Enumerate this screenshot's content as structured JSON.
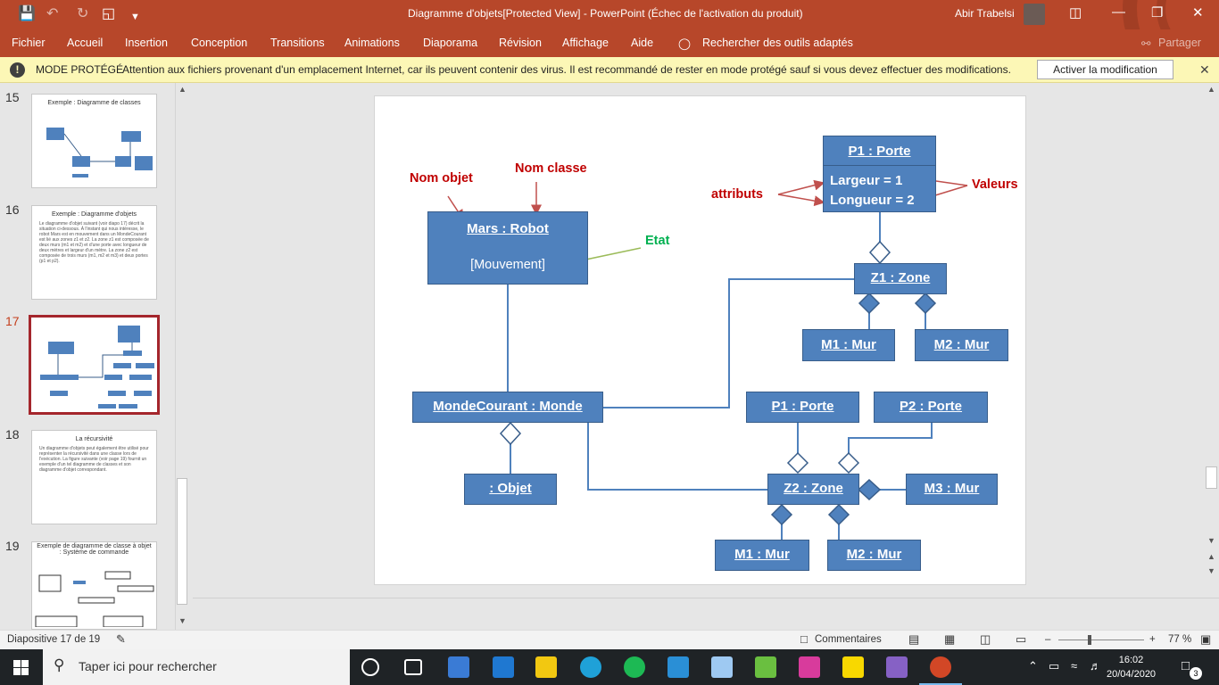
{
  "titlebar": {
    "window_title": "Diagramme d'objets[Protected View]  -  PowerPoint (Échec de l'activation du produit)",
    "user_name": "Abir Trabelsi"
  },
  "menu": {
    "items": [
      "Fichier",
      "Accueil",
      "Insertion",
      "Conception",
      "Transitions",
      "Animations",
      "Diaporama",
      "Révision",
      "Affichage",
      "Aide"
    ],
    "search_label": "Rechercher des outils adaptés",
    "share_label": "Partager"
  },
  "protected": {
    "title": "MODE PROTÉGÉ",
    "message": "Attention aux fichiers provenant d'un emplacement Internet, car ils peuvent contenir des virus. Il est recommandé de rester en mode protégé sauf si vous devez effectuer des modifications.",
    "enable_button": "Activer la modification",
    "icon_glyph": "!"
  },
  "thumbnails": [
    {
      "num": "15",
      "title": "Exemple : Diagramme de classes",
      "body": ""
    },
    {
      "num": "16",
      "title": "Exemple : Diagramme d'objets",
      "body": "Le diagramme d'objet suivant (voir diapo 17) décrit la situation ci-dessous. À l'instant qui nous intéresse, le robot Mars est en mouvement dans un MondeCourant est lié aux zones z1 et z2. La zone z1 est composée de deux murs (m1 et m2) et d'une porte avec longueur de deux mètres et largeur d'un mètre. La zone z2 est composée de trois murs (m1, m2 et m3) et deux portes (p1 et p2)."
    },
    {
      "num": "17",
      "title": "",
      "body": ""
    },
    {
      "num": "18",
      "title": "La récursivité",
      "body": "Un diagramme d'objets peut également être utilisé pour représenter la récursivité dans une classe lors de l'exécution. La figure suivante (voir page 19) fournit un exemple d'un tel diagramme de classes et son diagramme d'objet correspondant."
    },
    {
      "num": "19",
      "title": "Exemple de diagramme de classe à objet : Système de commande",
      "body": ""
    }
  ],
  "diagram": {
    "mars": {
      "name": "Mars : Robot",
      "state": "[Mouvement]"
    },
    "monde": "MondeCourant : Monde",
    "objet": ": Objet",
    "p1_top": {
      "name": "P1 : Porte",
      "attr1": "Largeur = 1",
      "attr2": "Longueur = 2"
    },
    "z1": "Z1 : Zone",
    "z1_m1": "M1 : Mur",
    "z1_m2": "M2 : Mur",
    "p1": "P1 : Porte",
    "p2": "P2 : Porte",
    "z2": "Z2 : Zone",
    "m3": "M3 : Mur",
    "z2_m1": "M1 : Mur",
    "z2_m2": "M2 : Mur",
    "labels": {
      "nom_objet": "Nom objet",
      "nom_classe": "Nom classe",
      "etat": "Etat",
      "attributs": "attributs",
      "valeurs": "Valeurs"
    },
    "colors": {
      "box": "#4f81bd",
      "border": "#385d8a",
      "red_label": "#c00000",
      "green_label": "#00b050"
    }
  },
  "status": {
    "slide_info": "Diapositive 17 de 19",
    "comments": "Commentaires",
    "zoom": "77 %"
  },
  "taskbar": {
    "search_placeholder": "Taper ici pour rechercher",
    "time": "16:02",
    "date": "20/04/2020",
    "notifications": "3"
  }
}
